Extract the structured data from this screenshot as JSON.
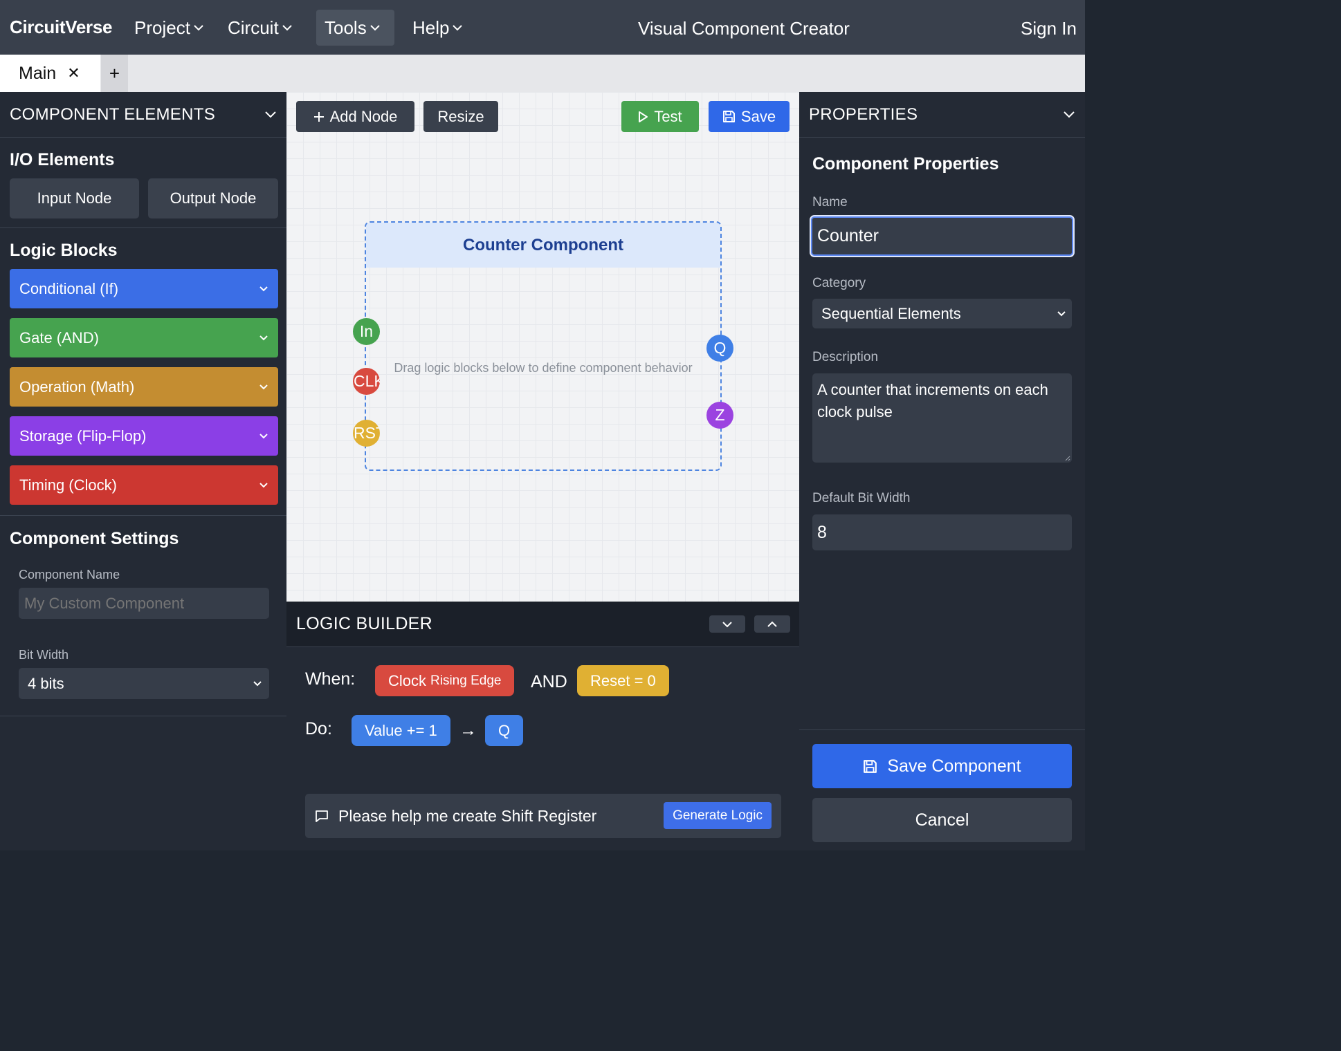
{
  "topbar": {
    "brand": "CircuitVerse",
    "menus": [
      {
        "label": "Project"
      },
      {
        "label": "Circuit"
      },
      {
        "label": "Tools",
        "active": true
      },
      {
        "label": "Help"
      }
    ],
    "title": "Visual Component Creator",
    "sign_in": "Sign In"
  },
  "tabs": {
    "active_tab": "Main",
    "close_glyph": "✕",
    "add_glyph": "+"
  },
  "left": {
    "header": "COMPONENT ELEMENTS",
    "io": {
      "title": "I/O Elements",
      "input_node": "Input Node",
      "output_node": "Output Node"
    },
    "logic_blocks": {
      "title": "Logic Blocks",
      "items": [
        {
          "label": "Conditional (If)",
          "color": "#3b6ee6"
        },
        {
          "label": "Gate (AND)",
          "color": "#46a34f"
        },
        {
          "label": "Operation (Math)",
          "color": "#c48d31"
        },
        {
          "label": "Storage (Flip-Flop)",
          "color": "#8b3fe6"
        },
        {
          "label": "Timing (Clock)",
          "color": "#cc3731"
        }
      ]
    },
    "settings": {
      "title": "Component Settings",
      "name_label": "Component Name",
      "name_placeholder": "My Custom Component",
      "name_value": "",
      "bitwidth_label": "Bit Width",
      "bitwidth_value": "4 bits"
    }
  },
  "canvas": {
    "toolbar": {
      "add_node": "Add Node",
      "resize": "Resize",
      "test": "Test",
      "save": "Save"
    },
    "component": {
      "title": "Counter Component",
      "hint": "Drag logic blocks below to define component behavior",
      "input_pins": [
        {
          "label": "In",
          "color": "#46a34f"
        },
        {
          "label": "CLK",
          "color": "#d84a3f"
        },
        {
          "label": "RST",
          "color": "#e0b033"
        }
      ],
      "output_pins": [
        {
          "label": "Q",
          "color": "#3f7fe6"
        },
        {
          "label": "Z",
          "color": "#9b43e0"
        }
      ]
    }
  },
  "logic_builder": {
    "header": "LOGIC BUILDER",
    "when_label": "When:",
    "clock_main": "Clock",
    "clock_sub": "Rising Edge",
    "and_text": "AND",
    "reset_chip": "Reset = 0",
    "do_label": "Do:",
    "value_chip": "Value += 1",
    "arrow": "→",
    "q_chip": "Q",
    "prompt_text": "Please help me create Shift Register",
    "generate": "Generate Logic"
  },
  "right": {
    "header": "PROPERTIES",
    "title": "Component Properties",
    "name_label": "Name",
    "name_value": "Counter",
    "category_label": "Category",
    "category_value": "Sequential Elements",
    "description_label": "Description",
    "description_value": "A counter that increments on each clock pulse",
    "bitwidth_label": "Default Bit Width",
    "bitwidth_value": "8",
    "save_component": "Save Component",
    "cancel": "Cancel"
  }
}
